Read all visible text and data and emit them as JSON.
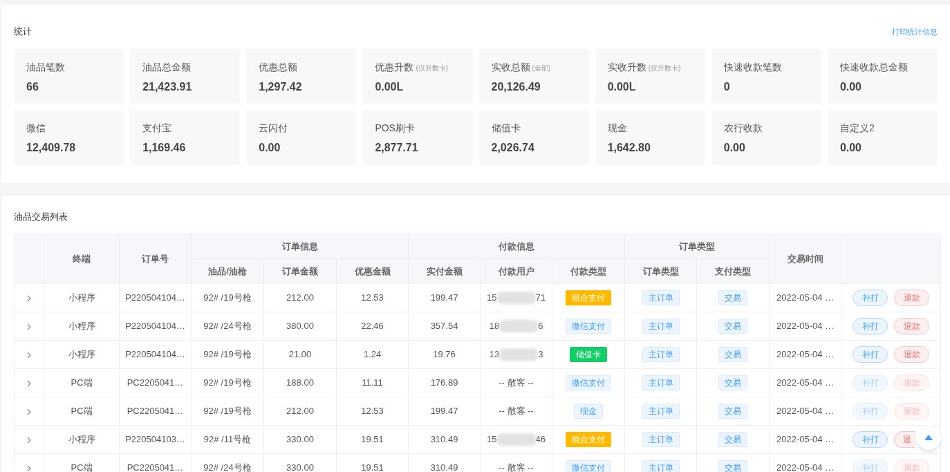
{
  "stats": {
    "title": "统计",
    "print_link": "打印统计信息",
    "cards": [
      {
        "label": "油品笔数",
        "value": "66"
      },
      {
        "label": "油品总金额",
        "value": "21,423.91"
      },
      {
        "label": "优惠总额",
        "value": "1,297.42"
      },
      {
        "label": "优惠升数",
        "note": "(仅升数卡)",
        "value": "0.00L"
      },
      {
        "label": "实收总额",
        "note": "(全部)",
        "value": "20,126.49"
      },
      {
        "label": "实收升数",
        "note": "(仅升数卡)",
        "value": "0.00L"
      },
      {
        "label": "快速收款笔数",
        "value": "0"
      },
      {
        "label": "快速收款总金额",
        "value": "0.00"
      },
      {
        "label": "微信",
        "value": "12,409.78"
      },
      {
        "label": "支付宝",
        "value": "1,169.46"
      },
      {
        "label": "云闪付",
        "value": "0.00"
      },
      {
        "label": "POS刷卡",
        "value": "2,877.71"
      },
      {
        "label": "储值卡",
        "value": "2,026.74"
      },
      {
        "label": "现金",
        "value": "1,642.80"
      },
      {
        "label": "农行收款",
        "value": "0.00"
      },
      {
        "label": "自定义2",
        "value": "0.00"
      }
    ]
  },
  "table": {
    "title": "油品交易列表",
    "groups": [
      "订单信息",
      "付款信息",
      "订单类型"
    ],
    "columns": [
      "终端",
      "订单号",
      "油品/油枪",
      "订单金额",
      "优惠金额",
      "实付金额",
      "付款用户",
      "付款类型",
      "订单类型",
      "支付类型",
      "交易时间"
    ],
    "rows": [
      {
        "terminal": "小程序",
        "order_no": "P220504104…",
        "oil": "92# /19号枪",
        "amount": "212.00",
        "discount": "12.53",
        "paid": "199.47",
        "user": {
          "kind": "masked",
          "start": "15",
          "end": "71"
        },
        "pay_type": {
          "label": "组合支付",
          "kind": "solid",
          "color": "#ffba00"
        },
        "order_type": "主订单",
        "pay_kind": "交易",
        "time": "2022-05-04 …",
        "reprint": "补打",
        "refund": "退款",
        "disabled": false
      },
      {
        "terminal": "小程序",
        "order_no": "P220504104…",
        "oil": "92# /24号枪",
        "amount": "380.00",
        "discount": "22.46",
        "paid": "357.54",
        "user": {
          "kind": "masked",
          "start": "18",
          "end": "6"
        },
        "pay_type": {
          "label": "微信支付",
          "kind": "light",
          "color": "#409eff"
        },
        "order_type": "主订单",
        "pay_kind": "交易",
        "time": "2022-05-04 …",
        "reprint": "补打",
        "refund": "退款",
        "disabled": false
      },
      {
        "terminal": "小程序",
        "order_no": "P220504104…",
        "oil": "92# /19号枪",
        "amount": "21.00",
        "discount": "1.24",
        "paid": "19.76",
        "user": {
          "kind": "masked",
          "start": "13",
          "end": "3"
        },
        "pay_type": {
          "label": "储值卡",
          "kind": "solid",
          "color": "#13ce66"
        },
        "order_type": "主订单",
        "pay_kind": "交易",
        "time": "2022-05-04 …",
        "reprint": "补打",
        "refund": "退款",
        "disabled": false
      },
      {
        "terminal": "PC端",
        "order_no": "PC2205041…",
        "oil": "92# /19号枪",
        "amount": "188.00",
        "discount": "11.11",
        "paid": "176.89",
        "user": {
          "kind": "guest",
          "text": "-- 散客 --"
        },
        "pay_type": {
          "label": "微信支付",
          "kind": "light",
          "color": "#409eff"
        },
        "order_type": "主订单",
        "pay_kind": "交易",
        "time": "2022-05-04 …",
        "reprint": "补打",
        "refund": "退款",
        "disabled": true
      },
      {
        "terminal": "PC端",
        "order_no": "PC2205041…",
        "oil": "92# /19号枪",
        "amount": "212.00",
        "discount": "12.53",
        "paid": "199.47",
        "user": {
          "kind": "guest",
          "text": "-- 散客 --"
        },
        "pay_type": {
          "label": "现金",
          "kind": "light",
          "color": "#409eff"
        },
        "order_type": "主订单",
        "pay_kind": "交易",
        "time": "2022-05-04 …",
        "reprint": "补打",
        "refund": "退款",
        "disabled": true
      },
      {
        "terminal": "小程序",
        "order_no": "P220504103…",
        "oil": "92# /11号枪",
        "amount": "330.00",
        "discount": "19.51",
        "paid": "310.49",
        "user": {
          "kind": "masked",
          "start": "15",
          "end": "46"
        },
        "pay_type": {
          "label": "组合支付",
          "kind": "solid",
          "color": "#ffba00"
        },
        "order_type": "主订单",
        "pay_kind": "交易",
        "time": "2022-05-04 …",
        "reprint": "补打",
        "refund": "退",
        "disabled": false
      },
      {
        "terminal": "PC端",
        "order_no": "PC2205041…",
        "oil": "92# /24号枪",
        "amount": "330.00",
        "discount": "19.51",
        "paid": "310.49",
        "user": {
          "kind": "guest",
          "text": "-- 散客 --"
        },
        "pay_type": {
          "label": "微信支付",
          "kind": "light",
          "color": "#409eff"
        },
        "order_type": "主订单",
        "pay_kind": "交易",
        "time": "2022-05-04 …",
        "reprint": "补打",
        "refund": "退款",
        "disabled": true
      }
    ]
  }
}
